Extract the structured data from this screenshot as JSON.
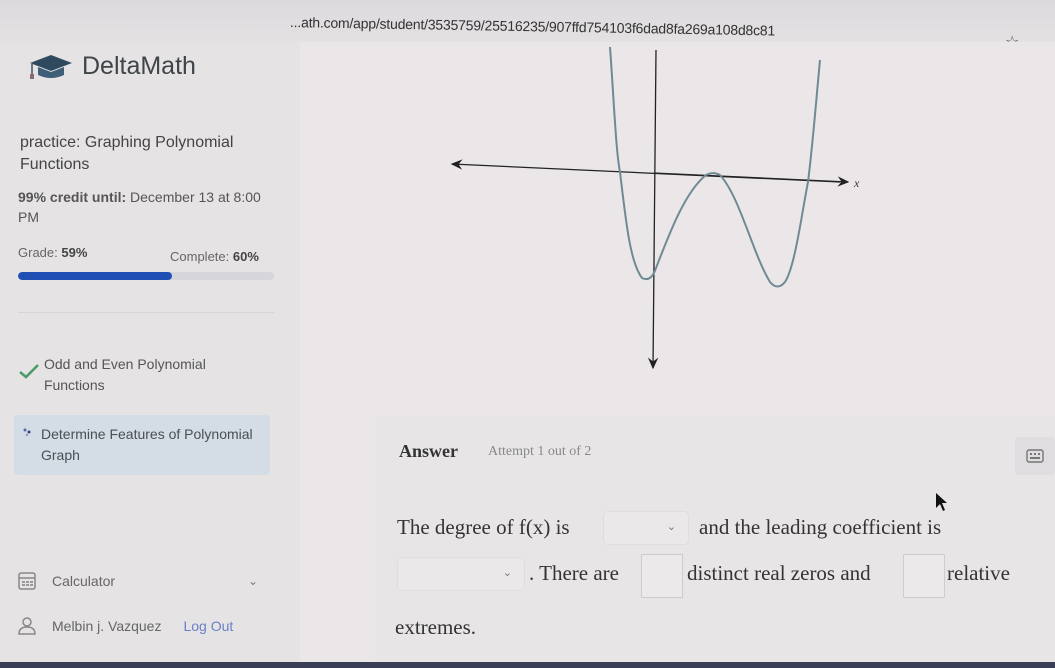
{
  "browser": {
    "url": "...ath.com/app/student/3535759/25516235/907ffd754103f6dad8fa269a108d8c81",
    "bookmark_icon": "star-icon"
  },
  "sidebar": {
    "brand": "DeltaMath",
    "brand_icon": "graduation-cap-icon",
    "practice_title": "practice: Graphing Polynomial Functions",
    "credit_label": "99% credit until:",
    "credit_value": "December 13 at 8:00 PM",
    "grade_label": "Grade:",
    "grade_value": "59%",
    "complete_label": "Complete:",
    "complete_value": "60%",
    "progress_fraction": 0.6,
    "progress_color": "#1f4fb5",
    "topics": [
      {
        "label": "Odd and Even Polynomial Functions",
        "status": "completed",
        "icon": "checkmark-icon"
      },
      {
        "label": "Determine Features of Polynomial Graph",
        "status": "active",
        "icon": "loading-dots-icon"
      }
    ],
    "calculator_label": "Calculator",
    "user_name": "Melbin j. Vazquez",
    "logout_label": "Log Out"
  },
  "graph": {
    "x_axis_label": "x",
    "description": "Quartic polynomial graph with leading positive coefficient, four zeros (one tangent at a double root), three relative extrema"
  },
  "answer": {
    "title": "Answer",
    "attempt": "Attempt 1 out of 2",
    "q_part1": "The degree of f(x) is",
    "q_part2": "and the leading coefficient is",
    "q_part3": ". There are",
    "q_part4": "distinct real zeros and",
    "q_part5": "relative",
    "q_part6": "extremes.",
    "degree_select_value": "",
    "coefficient_select_value": "",
    "zeros_input_value": "",
    "extremes_input_value": ""
  }
}
